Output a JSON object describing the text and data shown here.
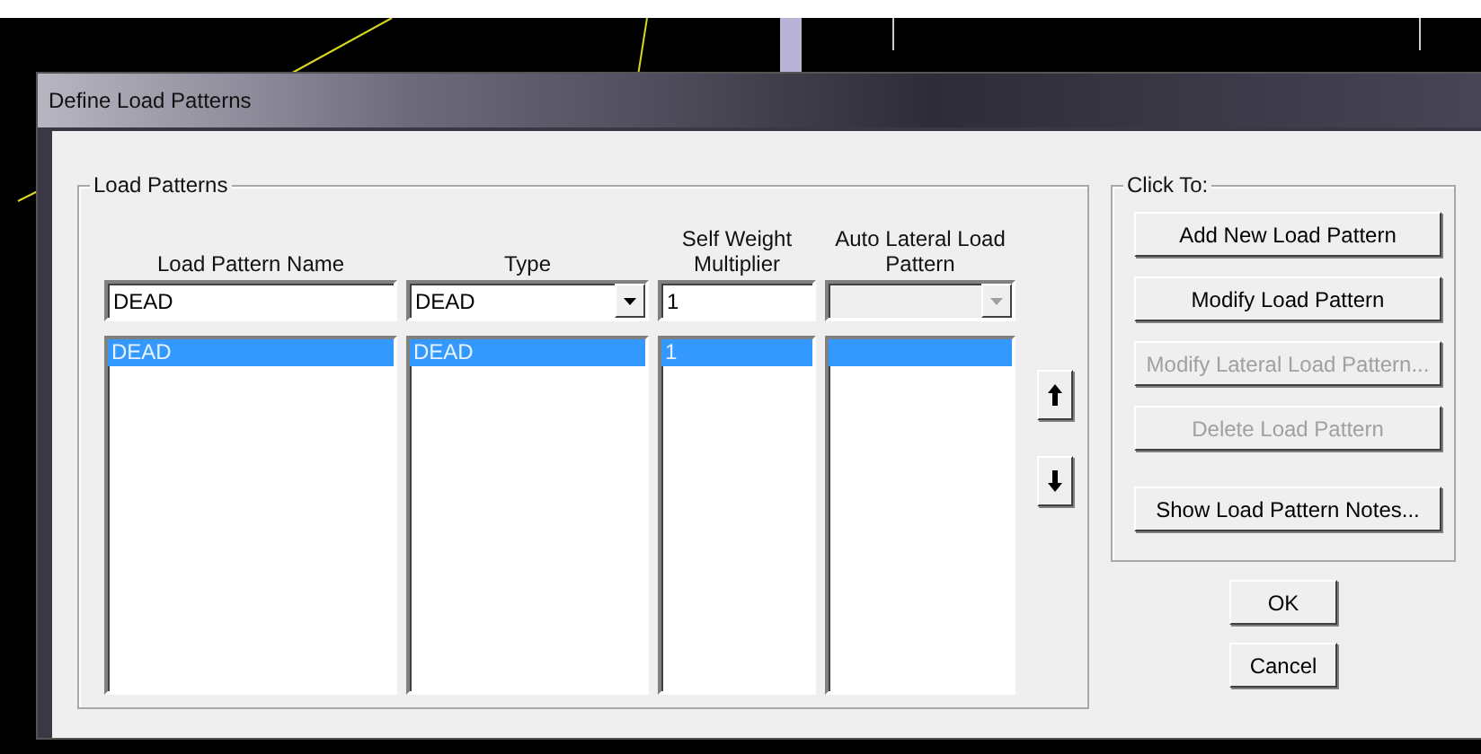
{
  "window": {
    "title": "Define Load Patterns"
  },
  "load_patterns": {
    "label": "Load Patterns",
    "columns": [
      "Load Pattern Name",
      "Type",
      "Self Weight Multiplier",
      "Auto Lateral Load Pattern"
    ],
    "inputs": {
      "name": "DEAD",
      "type": "DEAD",
      "multiplier": "1",
      "lateral_disabled": true
    },
    "rows": [
      {
        "cells": [
          "DEAD",
          "DEAD",
          "1"
        ],
        "selected": true
      }
    ],
    "move_buttons": [
      {
        "kind": "up"
      },
      {
        "kind": "down"
      }
    ]
  },
  "click_to": {
    "label": "Click To:",
    "buttons": [
      {
        "label": "Add New Load Pattern",
        "disabled": false
      },
      {
        "label": "Modify Load Pattern",
        "disabled": false
      },
      {
        "label": "Modify Lateral Load Pattern...",
        "disabled": true
      },
      {
        "label": "Delete Load Pattern",
        "disabled": true
      },
      {
        "label": "Show Load Pattern Notes...",
        "disabled": false
      }
    ]
  },
  "buttons": [
    "OK",
    "Cancel"
  ]
}
